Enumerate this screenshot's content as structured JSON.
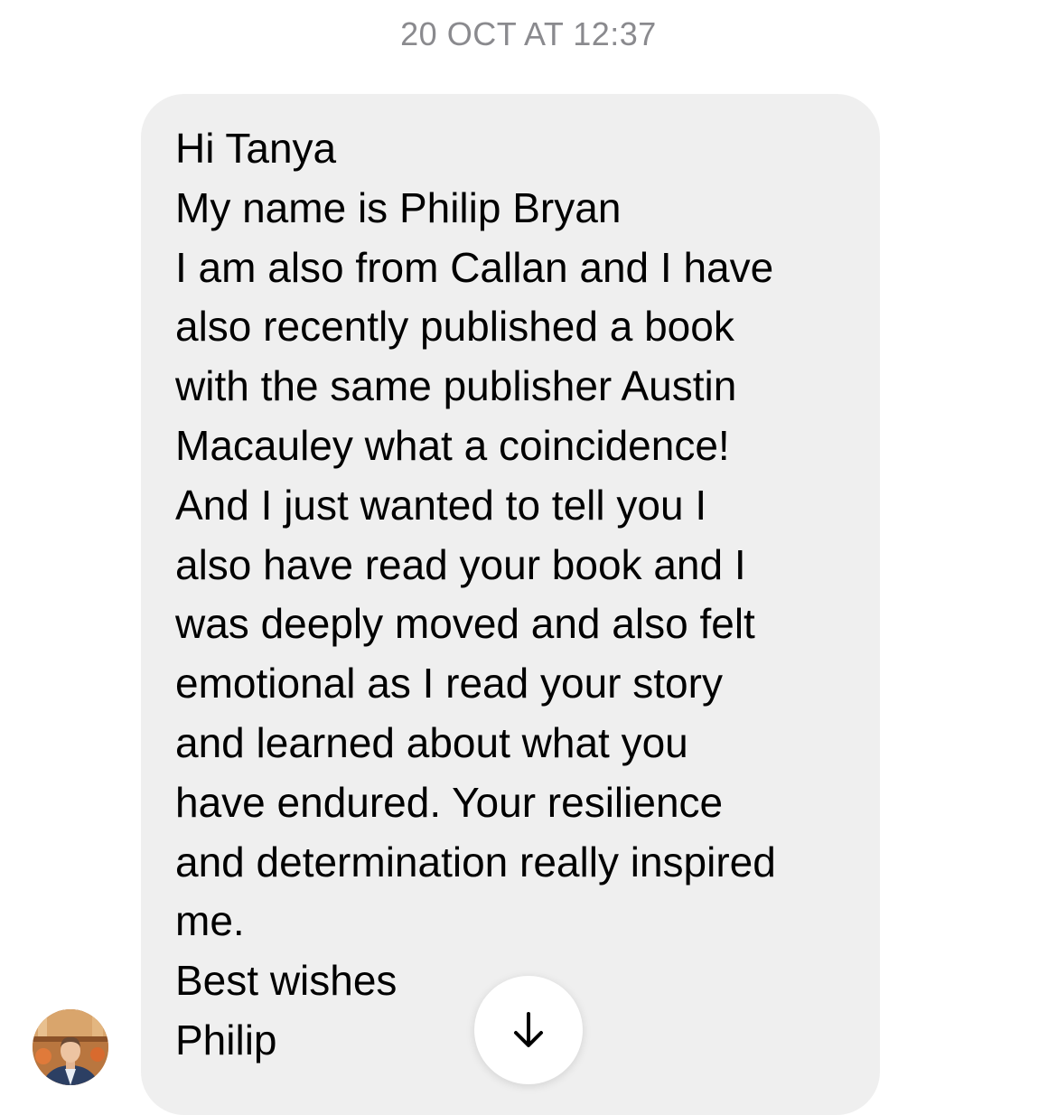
{
  "conversation": {
    "timestamp": "20 OCT AT 12:37"
  },
  "message": {
    "lines": [
      "Hi Tanya",
      "My name is Philip Bryan",
      "I am also from Callan and I have",
      "also recently published a book",
      "with the same publisher Austin",
      "Macauley what a coincidence!",
      "And I just wanted to tell you I",
      "also have read your book and I",
      "was deeply moved and also felt",
      "emotional as I read your story",
      "and learned about what you",
      "have endured. Your resilience",
      "and determination really inspired",
      "me.",
      "Best wishes",
      "Philip"
    ]
  },
  "sender": {
    "avatar_icon": "profile-photo"
  },
  "controls": {
    "scroll_down_icon": "arrow-down-icon"
  },
  "colors": {
    "bubble_background": "#efefef",
    "timestamp_text": "#8a8a8e",
    "message_text": "#000000"
  }
}
